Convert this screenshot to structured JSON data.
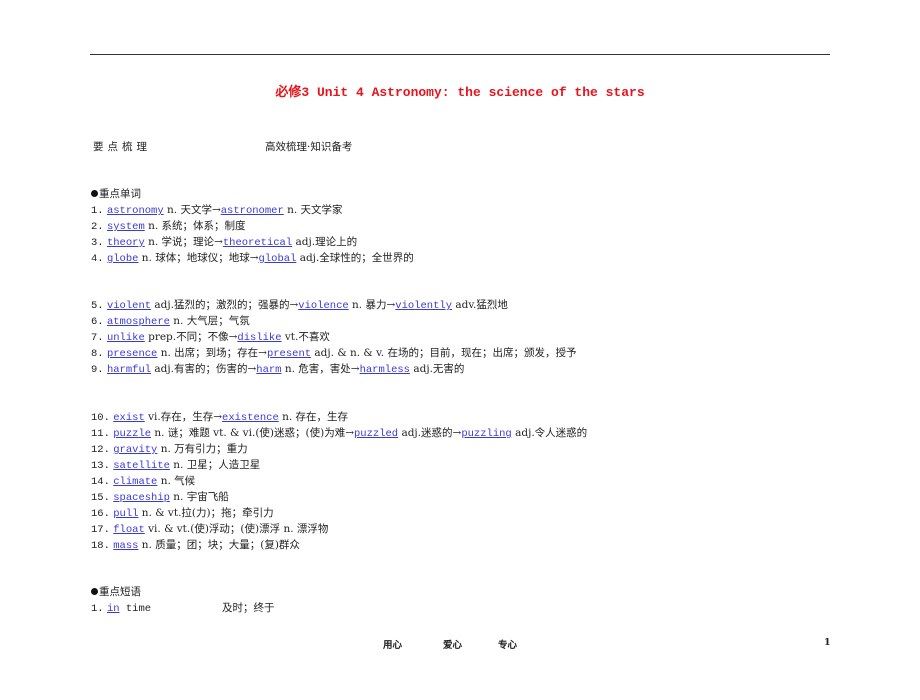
{
  "title": "必修3  Unit 4  Astronomy: the science of the stars",
  "section": {
    "left": "要点梳理",
    "right": "高效梳理·知识备考"
  },
  "vocab_heading": "重点单词",
  "vocab": [
    {
      "n": "1.",
      "parts": [
        {
          "w": "astronomy"
        },
        {
          "t": " n. 天文学→"
        },
        {
          "w": "astronomer"
        },
        {
          "t": " n. 天文学家"
        }
      ]
    },
    {
      "n": "2.",
      "parts": [
        {
          "w": "system"
        },
        {
          "t": " n. 系统；体系；制度"
        }
      ]
    },
    {
      "n": "3.",
      "parts": [
        {
          "w": "theory"
        },
        {
          "t": " n. 学说；理论→"
        },
        {
          "w": "theoretical"
        },
        {
          "t": " adj.理论上的"
        }
      ]
    },
    {
      "n": "4.",
      "parts": [
        {
          "w": "globe"
        },
        {
          "t": " n. 球体；地球仪；地球→"
        },
        {
          "w": "global"
        },
        {
          "t": " adj.全球性的；全世界的"
        }
      ]
    },
    {
      "n": "5.",
      "parts": [
        {
          "w": "violent"
        },
        {
          "t": " adj.猛烈的；激烈的；强暴的→"
        },
        {
          "w": "violence"
        },
        {
          "t": " n. 暴力→"
        },
        {
          "w": "violently"
        },
        {
          "t": " adv.猛烈地"
        }
      ]
    },
    {
      "n": "6.",
      "parts": [
        {
          "w": "atmosphere"
        },
        {
          "t": " n. 大气层；气氛"
        }
      ]
    },
    {
      "n": "7.",
      "parts": [
        {
          "w": "unlike"
        },
        {
          "t": " prep.不同；不像→"
        },
        {
          "w": "dislike"
        },
        {
          "t": " vt.不喜欢"
        }
      ]
    },
    {
      "n": "8.",
      "parts": [
        {
          "w": "presence"
        },
        {
          "t": " n. 出席；到场；存在→"
        },
        {
          "w": "present"
        },
        {
          "t": " adj. & n. & v. 在场的；目前，现在；出席；颁发，授予"
        }
      ]
    },
    {
      "n": "9.",
      "parts": [
        {
          "w": "harmful"
        },
        {
          "t": " adj.有害的；伤害的→"
        },
        {
          "w": "harm"
        },
        {
          "t": " n. 危害，害处→"
        },
        {
          "w": "harmless"
        },
        {
          "t": " adj.无害的"
        }
      ]
    },
    {
      "n": "10.",
      "parts": [
        {
          "w": "exist"
        },
        {
          "t": " vi.存在，生存→"
        },
        {
          "w": "existence"
        },
        {
          "t": " n. 存在，生存"
        }
      ]
    },
    {
      "n": "11.",
      "parts": [
        {
          "w": "puzzle"
        },
        {
          "t": " n. 谜；难题 vt. & vi.(使)迷惑；(使)为难→"
        },
        {
          "w": "puzzled"
        },
        {
          "t": " adj.迷惑的→"
        },
        {
          "w": "puzzling"
        },
        {
          "t": " adj.令人迷惑的"
        }
      ]
    },
    {
      "n": "12.",
      "parts": [
        {
          "w": "gravity"
        },
        {
          "t": " n. 万有引力；重力"
        }
      ]
    },
    {
      "n": "13.",
      "parts": [
        {
          "w": "satellite"
        },
        {
          "t": " n. 卫星；人造卫星"
        }
      ]
    },
    {
      "n": "14.",
      "parts": [
        {
          "w": "climate"
        },
        {
          "t": " n. 气候"
        }
      ]
    },
    {
      "n": "15.",
      "parts": [
        {
          "w": "spaceship"
        },
        {
          "t": " n. 宇宙飞船"
        }
      ]
    },
    {
      "n": "16.",
      "parts": [
        {
          "w": "pull"
        },
        {
          "t": " n. & vt.拉(力)；拖；牵引力"
        }
      ]
    },
    {
      "n": "17.",
      "parts": [
        {
          "w": "float"
        },
        {
          "t": " vi. & vt.(使)浮动；(使)漂浮 n. 漂浮物"
        }
      ]
    },
    {
      "n": "18.",
      "parts": [
        {
          "w": "mass"
        },
        {
          "t": " n. 质量；团；块；大量；(复)群众"
        }
      ]
    }
  ],
  "phrase_heading": "重点短语",
  "phrases": [
    {
      "n": "1.",
      "word": "in",
      "rest": " time",
      "meaning": "及时；终于"
    }
  ],
  "footer": {
    "items": [
      "用心",
      "爱心",
      "专心"
    ],
    "page": "1"
  },
  "colors": {
    "title": "#e8141c",
    "link": "#3a3ad6"
  }
}
